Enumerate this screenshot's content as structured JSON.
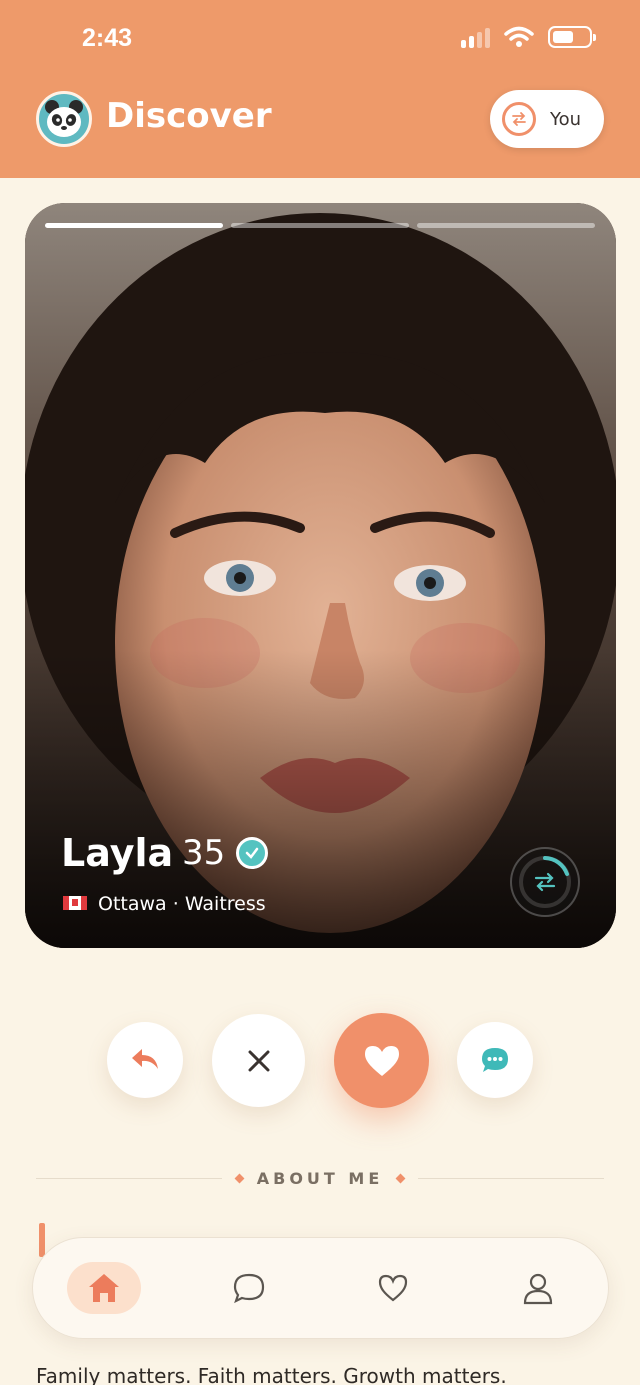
{
  "status_bar": {
    "time": "2:43"
  },
  "header": {
    "title": "Discover",
    "you_label": "You"
  },
  "card": {
    "name": "Layla",
    "age": "35",
    "city": "Ottawa",
    "occupation": "Waitress",
    "separator": "·",
    "photo_count": 3,
    "active_photo": 1
  },
  "actions": [
    "undo",
    "pass",
    "like",
    "message"
  ],
  "section": {
    "about_title": "ABOUT ME"
  },
  "bio": {
    "text": "Family matters. Faith matters. Growth matters."
  },
  "nav": {
    "items": [
      "home",
      "chats",
      "likes",
      "profile"
    ],
    "active": "home"
  },
  "colors": {
    "accent": "#ee9a6a",
    "teal": "#54c3c0",
    "background": "#fbf4e6"
  },
  "icons": [
    "panda-logo-icon",
    "swap-icon",
    "verified-check-icon",
    "canada-flag-icon",
    "undo-icon",
    "close-icon",
    "heart-icon",
    "chat-bubble-icon",
    "home-icon",
    "chat-icon",
    "heart-outline-icon",
    "user-icon"
  ]
}
